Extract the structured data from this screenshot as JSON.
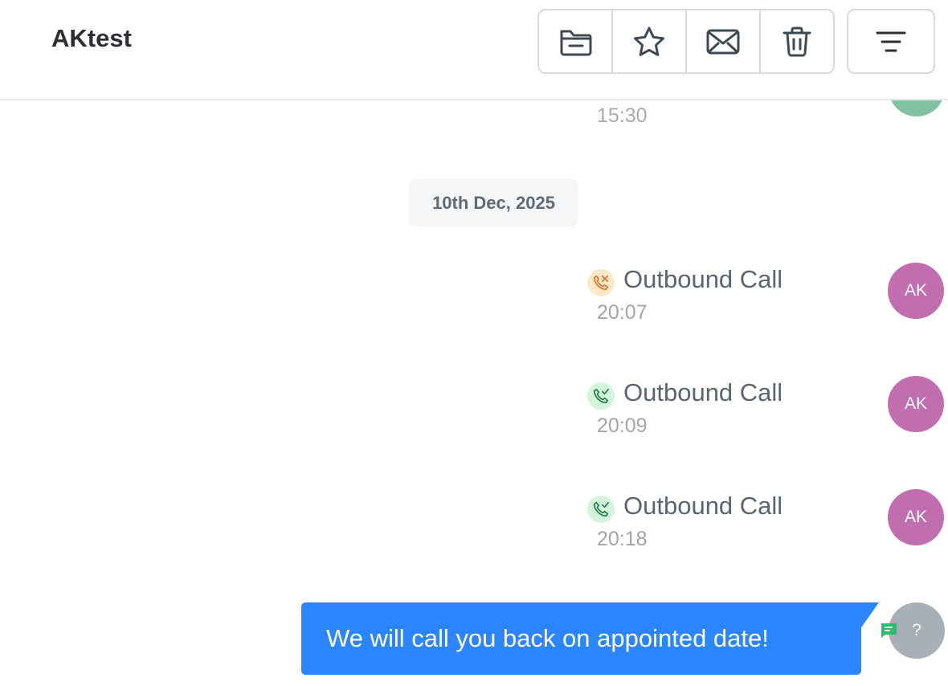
{
  "header": {
    "title": "AKtest",
    "toolbar": [
      {
        "icon": "folder-minus-icon"
      },
      {
        "icon": "star-icon"
      },
      {
        "icon": "mail-icon"
      },
      {
        "icon": "trash-icon"
      }
    ],
    "filter_icon": "filter-icon"
  },
  "timeline": {
    "previous_time": "15:30",
    "date_separator": "10th Dec, 2025",
    "calls": [
      {
        "label": "Outbound Call",
        "time": "20:07",
        "status": "missed",
        "avatar": "AK"
      },
      {
        "label": "Outbound Call",
        "time": "20:09",
        "status": "answered",
        "avatar": "AK"
      },
      {
        "label": "Outbound Call",
        "time": "20:18",
        "status": "answered",
        "avatar": "AK"
      }
    ],
    "message": {
      "text": "We will call you back on appointed date!",
      "avatar": "?"
    }
  },
  "colors": {
    "accent": "#2a85ff",
    "avatar": "#c16eb0",
    "missed_bg": "#fde9c7",
    "missed_fg": "#e0702a",
    "answered_bg": "#d3f5dd",
    "answered_fg": "#1f7a45",
    "badge_green": "#23c16b"
  }
}
